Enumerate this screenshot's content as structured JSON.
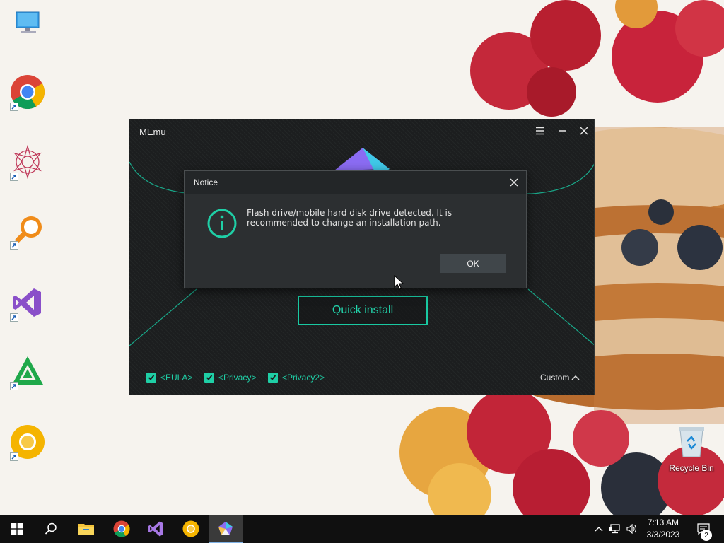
{
  "desktop": {
    "icons": [
      {
        "name": "This PC"
      },
      {
        "name": "Google Chrome"
      },
      {
        "name": "Mandala app"
      },
      {
        "name": "Search tool"
      },
      {
        "name": "Visual Studio"
      },
      {
        "name": "Triangle app"
      },
      {
        "name": "Chrome Canary"
      }
    ],
    "recycle_bin_label": "Recycle Bin"
  },
  "memu_window": {
    "title": "MEmu",
    "quick_install_label": "Quick install",
    "agreements": [
      {
        "label": "<EULA>",
        "checked": true
      },
      {
        "label": "<Privacy>",
        "checked": true
      },
      {
        "label": "<Privacy2>",
        "checked": true
      }
    ],
    "custom_label": "Custom",
    "accent_color": "#1fcfa6"
  },
  "notice_dialog": {
    "title": "Notice",
    "message": "Flash drive/mobile hard disk drive detected. It is recommended to change an installation path.",
    "ok_label": "OK"
  },
  "taskbar": {
    "pinned": [
      "windows-start",
      "search",
      "file-explorer",
      "google-chrome",
      "visual-studio",
      "chrome-canary",
      "memu"
    ],
    "active": "memu",
    "clock": {
      "time": "7:13 AM",
      "date": "3/3/2023"
    },
    "notification_count": "2"
  }
}
